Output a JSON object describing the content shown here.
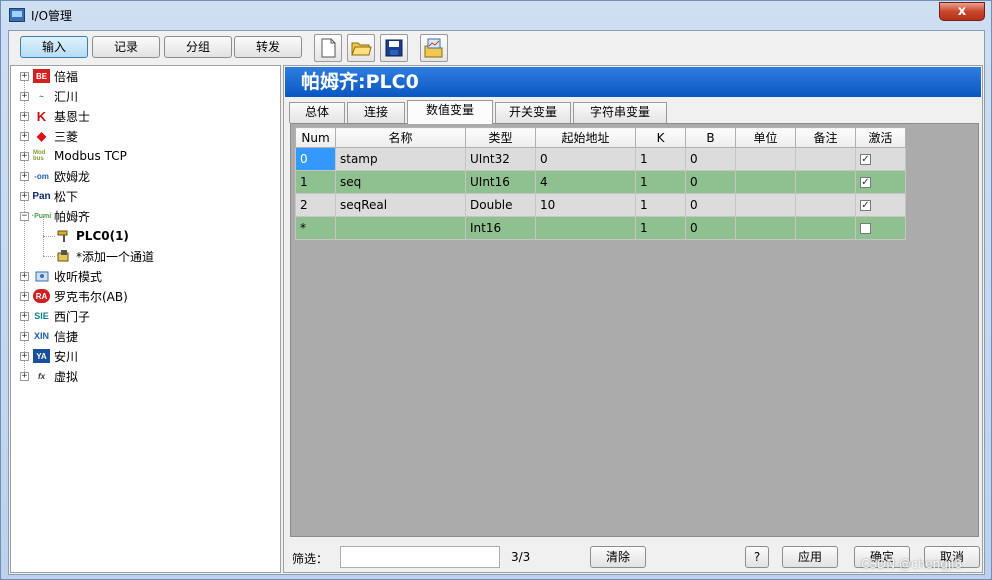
{
  "window": {
    "title": "I/O管理",
    "close": "x"
  },
  "toolbar": {
    "buttons": [
      "输入",
      "记录",
      "分组",
      "转发"
    ],
    "icons": [
      "new-document-icon",
      "open-folder-icon",
      "save-disk-icon",
      "chart-folder-icon"
    ]
  },
  "tree": {
    "items": [
      {
        "label": "倍福",
        "badge": "BE",
        "color": "#d42020"
      },
      {
        "label": "汇川",
        "badge": "~",
        "color": "#1a7fc7"
      },
      {
        "label": "基恩士",
        "badge": "K",
        "color": "#cc1010"
      },
      {
        "label": "三菱",
        "badge": "◆",
        "color": "#e01010"
      },
      {
        "label": "Modbus TCP",
        "badge": "Mod bus",
        "color": "#7fa030"
      },
      {
        "label": "欧姆龙",
        "badge": "-om",
        "color": "#2060c0"
      },
      {
        "label": "松下",
        "badge": "Pan",
        "color": "#0b2b7a"
      },
      {
        "label": "帕姆齐",
        "badge": "·Pumi",
        "color": "#4aa050"
      },
      {
        "label": "PLC0(1)",
        "badge": "",
        "color": "#000000"
      },
      {
        "label": "*添加一个通道",
        "badge": "",
        "color": "#000000"
      },
      {
        "label": "收听模式",
        "badge": "",
        "color": "#3a6fb5"
      },
      {
        "label": "罗克韦尔(AB)",
        "badge": "RA",
        "color": "#d02020"
      },
      {
        "label": "西门子",
        "badge": "SIE",
        "color": "#108090"
      },
      {
        "label": "信捷",
        "badge": "XIN",
        "color": "#1a5fb0"
      },
      {
        "label": "安川",
        "badge": "YA",
        "color": "#1a4fa0"
      },
      {
        "label": "虚拟",
        "badge": "fx",
        "color": "#333333"
      }
    ]
  },
  "panel": {
    "header": "帕姆齐:PLC0",
    "tabs": [
      "总体",
      "连接",
      "数值变量",
      "开关变量",
      "字符串变量"
    ],
    "active_tab": "数值变量"
  },
  "grid": {
    "columns": [
      "Num",
      "名称",
      "类型",
      "起始地址",
      "K",
      "B",
      "单位",
      "备注",
      "激活"
    ],
    "rows": [
      {
        "num": "0",
        "name": "stamp",
        "type": "UInt32",
        "addr": "0",
        "k": "1",
        "b": "0",
        "unit": "",
        "note": "",
        "active": true
      },
      {
        "num": "1",
        "name": "seq",
        "type": "UInt16",
        "addr": "4",
        "k": "1",
        "b": "0",
        "unit": "",
        "note": "",
        "active": true
      },
      {
        "num": "2",
        "name": "seqReal",
        "type": "Double",
        "addr": "10",
        "k": "1",
        "b": "0",
        "unit": "",
        "note": "",
        "active": true
      },
      {
        "num": "*",
        "name": "",
        "type": "Int16",
        "addr": "",
        "k": "1",
        "b": "0",
        "unit": "",
        "note": "",
        "active": false
      }
    ]
  },
  "bottom": {
    "filter_label": "筛选：",
    "filter_value": "",
    "count": "3/3",
    "clear": "清除",
    "help": "?",
    "apply": "应用",
    "ok": "确定",
    "cancel": "取消"
  },
  "watermark": "CSDN @chengjl8"
}
